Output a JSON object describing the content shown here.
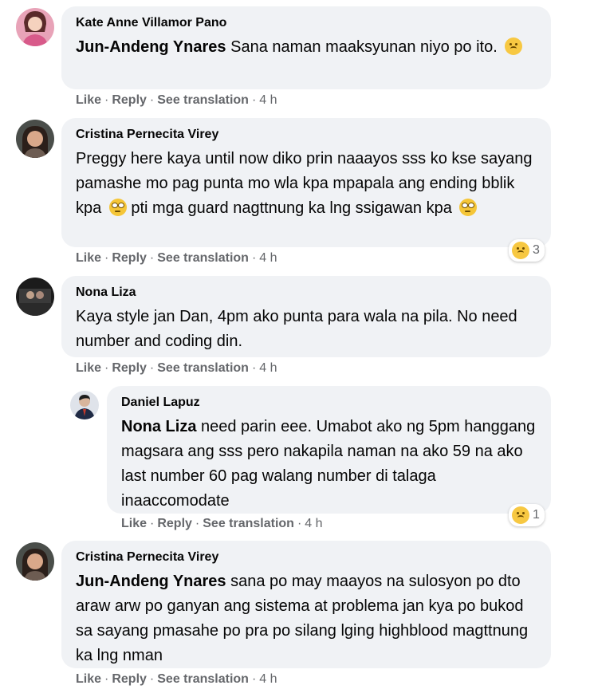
{
  "actions": {
    "like": "Like",
    "reply": "Reply",
    "translate": "See translation",
    "sep": "·"
  },
  "comments": [
    {
      "author": "Kate Anne Villamor Pano",
      "mention": "Jun-Andeng Ynares",
      "text": " Sana naman maaksyunan niyo po ito.",
      "time": "4 h"
    },
    {
      "author": "Cristina Pernecita Virey",
      "text": "Preggy here kaya until now diko prin naaayos sss ko kse sayang pamashe mo pag punta mo wla kpa mpapala ang ending bblik kpa",
      "text2": " pti mga guard nagttnung ka lng ssigawan kpa",
      "time": "4 h",
      "reaction_count": "3"
    },
    {
      "author": "Nona Liza",
      "text": "Kaya style jan Dan, 4pm ako punta para wala na pila. No need number and coding din.",
      "time": "4 h"
    },
    {
      "author": "Daniel Lapuz",
      "mention": "Nona Liza",
      "text": " need parin eee. Umabot ako ng 5pm hanggang magsara ang sss pero nakapila naman na ako 59 na ako last number 60 pag walang number di talaga inaaccomodate",
      "time": "4 h",
      "reaction_count": "1"
    },
    {
      "author": "Cristina Pernecita Virey",
      "mention": "Jun-Andeng Ynares",
      "text": " sana po may maayos na sulosyon po dto araw arw po ganyan ang sistema at problema jan kya po bukod sa sayang pmasahe po pra po silang lging highblood magttnung ka lng nman",
      "time": "4 h"
    }
  ],
  "colors": {
    "bubble": "#f0f2f5",
    "meta": "#65676b",
    "text": "#050505"
  }
}
